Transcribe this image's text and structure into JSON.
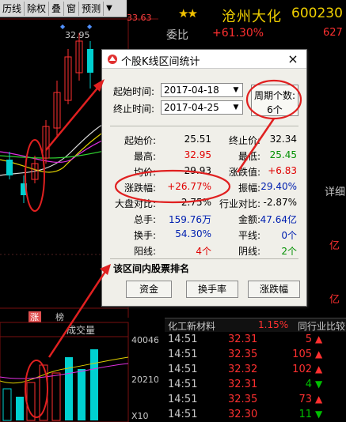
{
  "toolbar": {
    "items": [
      "历线",
      "除权",
      "叠",
      "窗",
      "预测"
    ],
    "dropdown": "▼"
  },
  "chart": {
    "price_high": "32.95",
    "top_label": "33.63",
    "date_markers": [
      "涨",
      "榜"
    ],
    "volume_title": "成交量",
    "vol_ticks": [
      "40046",
      "20210",
      "X10"
    ]
  },
  "header": {
    "stars": "★★",
    "name": "沧州大化",
    "code": "600230",
    "weibi_label": "委比",
    "weibi_value": "+61.30%",
    "weibi_right": "627"
  },
  "right_partial": [
    "详细",
    "亿",
    "亿"
  ],
  "sector": {
    "name": "化工新材料",
    "pct": "1.15%",
    "link": "同行业比较"
  },
  "ticks": [
    {
      "time": "14:51",
      "price": "32.31",
      "vol": "5",
      "dir": "up"
    },
    {
      "time": "14:51",
      "price": "32.35",
      "vol": "105",
      "dir": "up"
    },
    {
      "time": "14:51",
      "price": "32.32",
      "vol": "102",
      "dir": "up"
    },
    {
      "time": "14:51",
      "price": "32.31",
      "vol": "4",
      "dir": "down"
    },
    {
      "time": "14:51",
      "price": "32.35",
      "vol": "73",
      "dir": "up"
    },
    {
      "time": "14:51",
      "price": "32.30",
      "vol": "11",
      "dir": "down"
    }
  ],
  "dialog": {
    "title": "个股K线区间统计",
    "close": "×",
    "start_label": "起始时间:",
    "start_date": "2017-04-18",
    "end_label": "终止时间:",
    "end_date": "2017-04-25",
    "period_label": "周期个数:",
    "period_value": "6个",
    "stats": {
      "start_price_label": "起始价:",
      "start_price": "25.51",
      "end_price_label": "终止价:",
      "end_price": "32.34",
      "high_label": "最高:",
      "high": "32.95",
      "low_label": "最低:",
      "low": "25.45",
      "avg_label": "均价:",
      "avg": "29.93",
      "change_label": "涨跌值:",
      "change": "+6.83",
      "pct_label": "涨跌幅:",
      "pct": "+26.77%",
      "amp_label": "振幅:",
      "amp": "29.40%",
      "market_label": "大盘对比:",
      "market": "2.75%",
      "industry_label": "行业对比:",
      "industry": "-2.87%",
      "total_label": "总手:",
      "total": "159.76万",
      "amount_label": "金额:",
      "amount": "47.64亿",
      "turnover_label": "换手:",
      "turnover": "54.30%",
      "flat_label": "平线:",
      "flat": "0个",
      "yang_label": "阳线:",
      "yang": "4个",
      "yin_label": "阴线:",
      "yin": "2个"
    },
    "rank_title": "该区间内股票排名",
    "buttons": [
      "资金",
      "换手率",
      "涨跌幅"
    ]
  },
  "colors": {
    "up": "#ff3030",
    "down": "#00c000",
    "accent_red": "#e02020"
  }
}
